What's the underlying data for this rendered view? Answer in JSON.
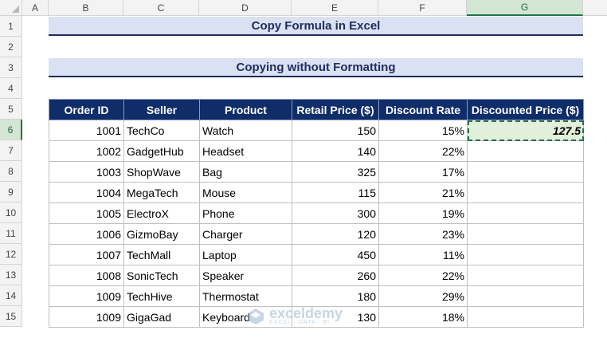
{
  "columns": [
    "A",
    "B",
    "C",
    "D",
    "E",
    "F",
    "G"
  ],
  "rows": [
    "1",
    "2",
    "3",
    "4",
    "5",
    "6",
    "7",
    "8",
    "9",
    "10",
    "11",
    "12",
    "13",
    "14",
    "15"
  ],
  "title": "Copy Formula in Excel",
  "subtitle": "Copying without Formatting",
  "table": {
    "headers": [
      "Order ID",
      "Seller",
      "Product",
      "Retail Price ($)",
      "Discount Rate",
      "Discounted Price ($)"
    ],
    "rows": [
      [
        "1001",
        "TechCo",
        "Watch",
        "150",
        "15%",
        "127.5"
      ],
      [
        "1002",
        "GadgetHub",
        "Headset",
        "140",
        "22%",
        ""
      ],
      [
        "1003",
        "ShopWave",
        "Bag",
        "325",
        "17%",
        ""
      ],
      [
        "1004",
        "MegaTech",
        "Mouse",
        "115",
        "21%",
        ""
      ],
      [
        "1005",
        "ElectroX",
        "Phone",
        "300",
        "19%",
        ""
      ],
      [
        "1006",
        "GizmoBay",
        "Charger",
        "120",
        "23%",
        ""
      ],
      [
        "1007",
        "TechMall",
        "Laptop",
        "450",
        "11%",
        ""
      ],
      [
        "1008",
        "SonicTech",
        "Speaker",
        "260",
        "22%",
        ""
      ],
      [
        "1009",
        "TechHive",
        "Thermostat",
        "180",
        "29%",
        ""
      ],
      [
        "1009",
        "GigaGad",
        "Keyboard",
        "130",
        "18%",
        ""
      ]
    ]
  },
  "active_cell": "G6",
  "colors": {
    "header_bg": "#0f2d69",
    "banner_bg": "#d9e1f2",
    "selection": "#217346",
    "active_fill": "#e2efda"
  },
  "watermark": {
    "name": "exceldemy",
    "tagline": "EXCEL · DATA · BI",
    "icon": "exceldemy-logo-icon"
  }
}
